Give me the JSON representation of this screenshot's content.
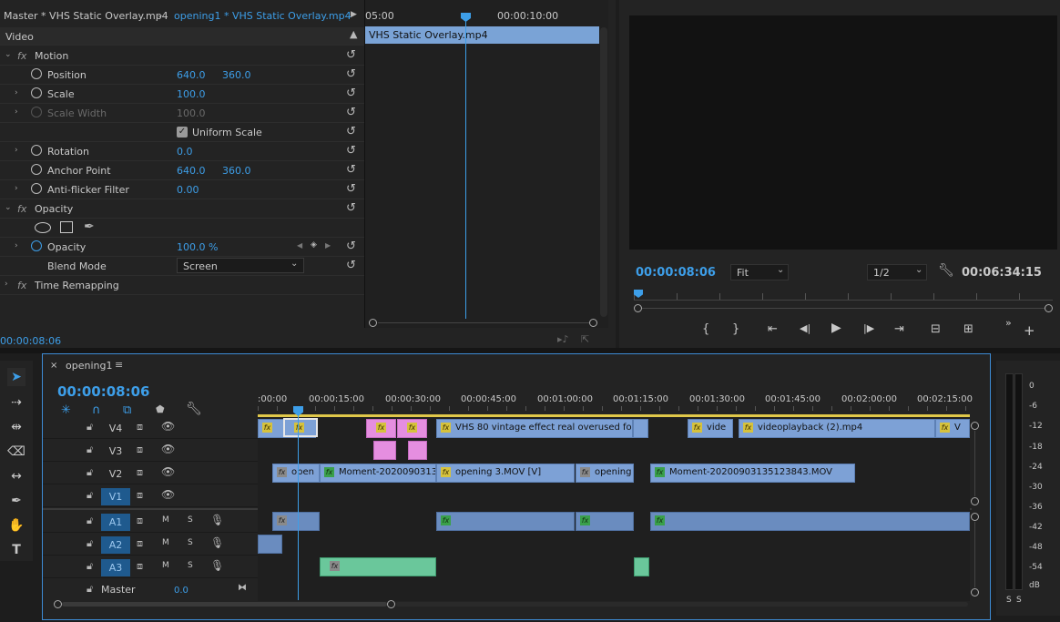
{
  "effect_controls": {
    "tab_master": "Master * VHS Static Overlay.mp4",
    "tab_seq": "opening1 * VHS Static Overlay.mp4",
    "section_video": "Video",
    "motion": {
      "label": "Motion"
    },
    "position": {
      "label": "Position",
      "x": "640.0",
      "y": "360.0"
    },
    "scale": {
      "label": "Scale",
      "value": "100.0"
    },
    "scale_width": {
      "label": "Scale Width",
      "value": "100.0"
    },
    "uniform_scale": {
      "label": "Uniform Scale",
      "checked": true
    },
    "rotation": {
      "label": "Rotation",
      "value": "0.0"
    },
    "anchor_point": {
      "label": "Anchor Point",
      "x": "640.0",
      "y": "360.0"
    },
    "anti_flicker": {
      "label": "Anti-flicker Filter",
      "value": "0.00"
    },
    "opacity_section": {
      "label": "Opacity"
    },
    "opacity": {
      "label": "Opacity",
      "value": "100.0 %"
    },
    "blend_mode": {
      "label": "Blend Mode",
      "value": "Screen"
    },
    "time_remapping": {
      "label": "Time Remapping"
    },
    "timecode": "00:00:08:06",
    "ruler_t1": "05:00",
    "ruler_t2": "00:00:10:00",
    "clip_name": "VHS Static Overlay.mp4"
  },
  "program_monitor": {
    "timecode": "00:00:08:06",
    "fit": "Fit",
    "resolution": "1/2",
    "duration": "00:06:34:15"
  },
  "timeline": {
    "sequence_name": "opening1",
    "timecode": "00:00:08:06",
    "ruler": [
      ":00:00",
      "00:00:15:00",
      "00:00:30:00",
      "00:00:45:00",
      "00:01:00:00",
      "00:01:15:00",
      "00:01:30:00",
      "00:01:45:00",
      "00:02:00:00",
      "00:02:15:00"
    ],
    "tracks": {
      "v4": "V4",
      "v3": "V3",
      "v2": "V2",
      "v1": "V1",
      "a1": "A1",
      "a2": "A2",
      "a3": "A3",
      "master": "Master",
      "master_val": "0.0",
      "m": "M",
      "s": "S"
    },
    "clips": {
      "v4_vhs": "VHS 80 vintage effect real overused footage r",
      "v4_vide": "vide",
      "v4_videoplayback": "videoplayback (2).mp4",
      "v4_v": "V",
      "v2_open": "open",
      "v2_moment1": "Moment-20200903131",
      "v2_opening3": "opening 3.MOV [V]",
      "v2_opening": "opening",
      "v2_moment2": "Moment-20200903135123843.MOV"
    }
  },
  "meter": {
    "scale": [
      "0",
      "-6",
      "-12",
      "-18",
      "-24",
      "-30",
      "-36",
      "-42",
      "-48",
      "-54",
      "dB"
    ],
    "solo_l": "S",
    "solo_r": "S"
  }
}
